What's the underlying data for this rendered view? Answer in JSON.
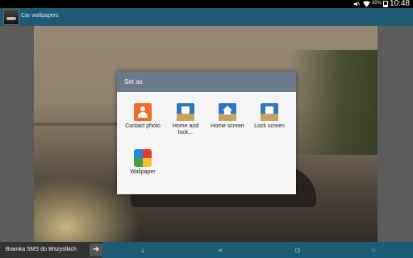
{
  "status_bar": {
    "battery_percent": "30%",
    "time": "10:48",
    "icons": [
      "mute-icon",
      "wifi-icon",
      "battery-icon"
    ]
  },
  "action_bar": {
    "title": "Car wallpapers",
    "app_icon": "car-app-icon"
  },
  "dialog": {
    "title": "Set as",
    "options": [
      {
        "label": "Contact photo",
        "icon": "contact-icon"
      },
      {
        "label": "Home and lock...",
        "icon": "home-lock-icon"
      },
      {
        "label": "Home screen",
        "icon": "home-screen-icon"
      },
      {
        "label": "Lock screen",
        "icon": "lock-screen-icon"
      },
      {
        "label": "Wallpaper",
        "icon": "wallpaper-icon"
      }
    ]
  },
  "bottom_bar": {
    "ad_text": "Bramka SMS do Wszystkich",
    "ad_arrow": "➜",
    "icons": [
      "download-icon",
      "share-icon",
      "crop-icon",
      "star-icon"
    ],
    "glyphs": {
      "download": "⤓",
      "share": "⋖",
      "crop": "⊡",
      "star": "☆"
    }
  },
  "colors": {
    "action_bar": "#1d5a74",
    "dialog_header": "#6b7a8a",
    "dialog_bg": "#f5f5f5"
  }
}
